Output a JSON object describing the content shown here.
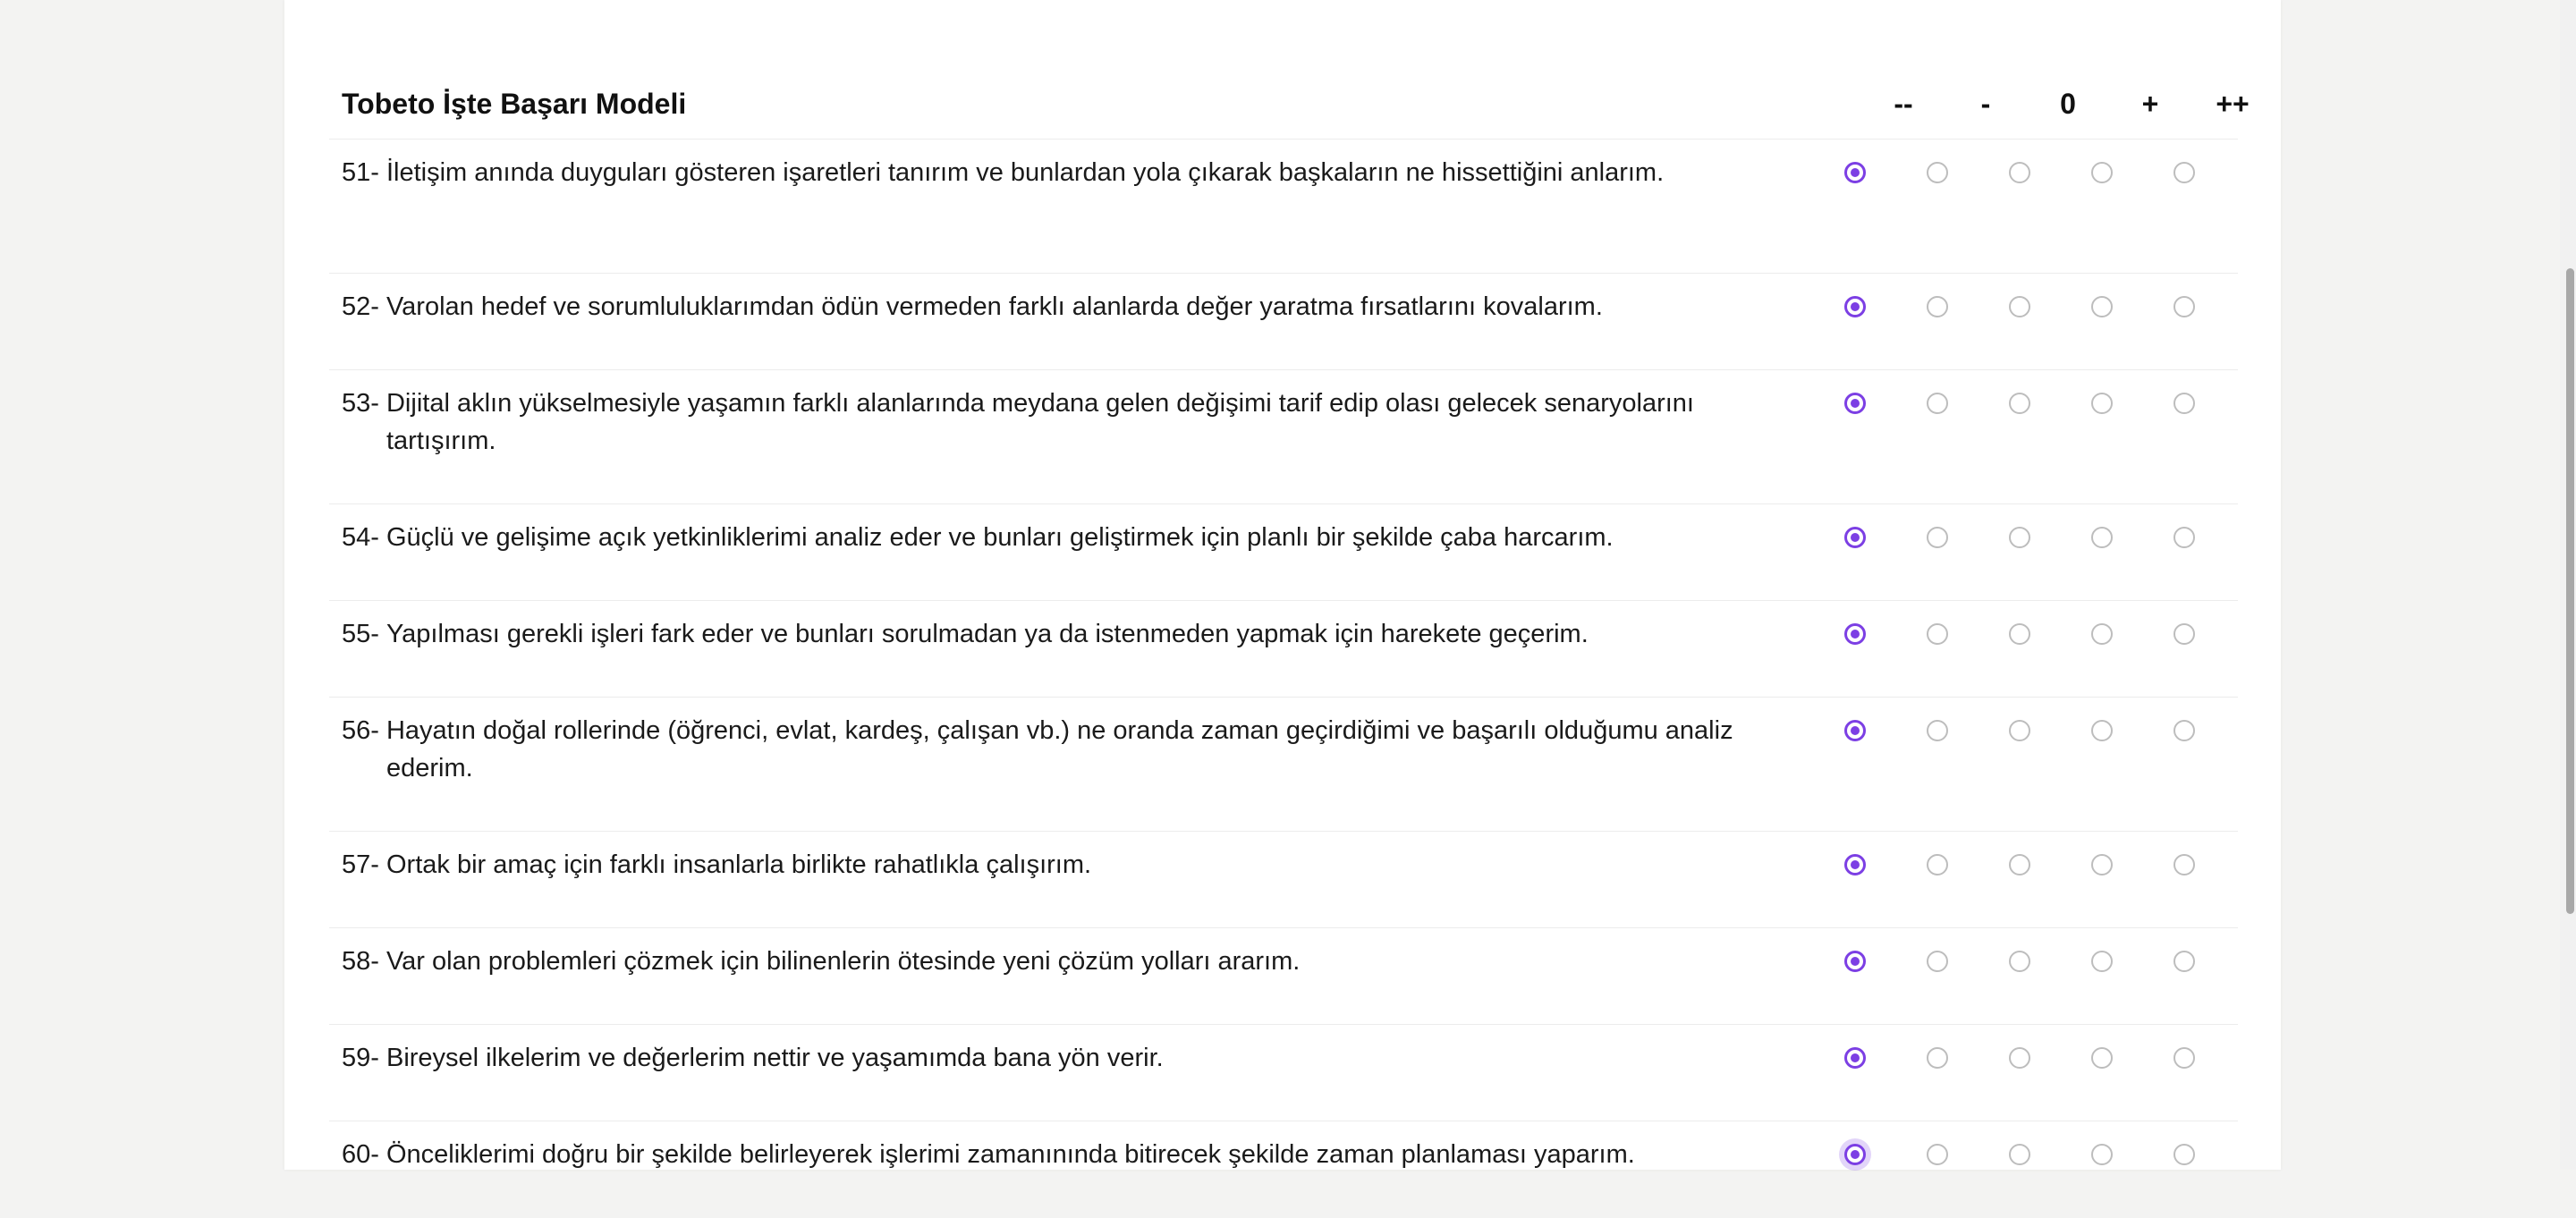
{
  "survey": {
    "title": "Tobeto İşte Başarı Modeli",
    "scale": [
      "--",
      "-",
      "0",
      "+",
      "++"
    ],
    "accent_color": "#7c3fe4",
    "questions": [
      {
        "num": "51-",
        "text": "İletişim anında duyguları gösteren işaretleri tanırım ve bunlardan yola çıkarak başkaların ne hissettiğini anlarım.",
        "selected": 0
      },
      {
        "num": "52-",
        "text": "Varolan hedef ve sorumluluklarımdan ödün vermeden farklı alanlarda değer yaratma fırsatlarını kovalarım.",
        "selected": 0
      },
      {
        "num": "53-",
        "text": "Dijital aklın yükselmesiyle yaşamın farklı alanlarında meydana gelen değişimi tarif edip olası gelecek senaryolarını tartışırım.",
        "selected": 0
      },
      {
        "num": "54-",
        "text": "Güçlü ve gelişime açık yetkinliklerimi analiz eder ve bunları geliştirmek için planlı bir şekilde çaba harcarım.",
        "selected": 0
      },
      {
        "num": "55-",
        "text": "Yapılması gerekli işleri fark eder ve bunları sorulmadan ya da istenmeden yapmak için harekete geçerim.",
        "selected": 0
      },
      {
        "num": "56-",
        "text": "Hayatın doğal rollerinde (öğrenci, evlat, kardeş, çalışan vb.) ne oranda zaman geçirdiğimi ve başarılı olduğumu analiz ederim.",
        "selected": 0
      },
      {
        "num": "57-",
        "text": "Ortak bir amaç için farklı insanlarla birlikte rahatlıkla çalışırım.",
        "selected": 0
      },
      {
        "num": "58-",
        "text": "Var olan problemleri çözmek için bilinenlerin ötesinde yeni çözüm yolları ararım.",
        "selected": 0
      },
      {
        "num": "59-",
        "text": "Bireysel ilkelerim ve değerlerim nettir ve yaşamımda bana yön verir.",
        "selected": 0
      },
      {
        "num": "60-",
        "text": "Önceliklerimi doğru bir şekilde belirleyerek işlerimi zamanınında bitirecek şekilde zaman planlaması yaparım.",
        "selected": 0
      }
    ]
  }
}
